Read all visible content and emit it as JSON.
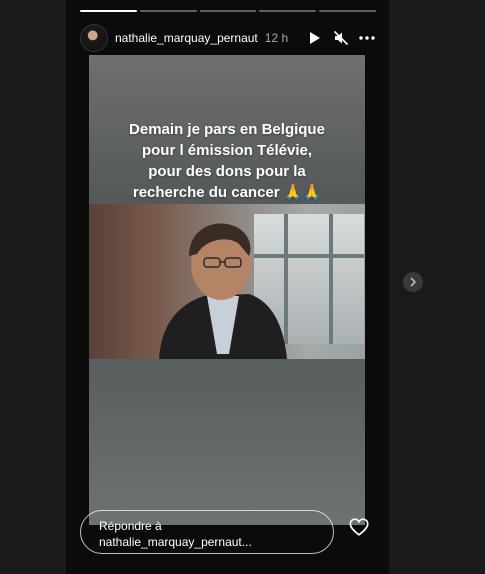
{
  "story": {
    "username": "nathalie_marquay_pernaut",
    "time": "12 h",
    "progress": {
      "segments": 5,
      "active_index": 0,
      "active_fill": 1.0
    }
  },
  "caption": {
    "lines": [
      "Demain je pars en Belgique",
      "pour l émission Télévie,",
      "pour des dons pour la",
      "recherche du cancer 🙏🙏"
    ]
  },
  "reply": {
    "line1": "Répondre à",
    "line2": "nathalie_marquay_pernaut..."
  },
  "icons": {
    "play": "play-icon",
    "mute": "mute-icon",
    "more": "more-icon",
    "heart": "heart-icon",
    "next": "chevron-right-icon"
  }
}
